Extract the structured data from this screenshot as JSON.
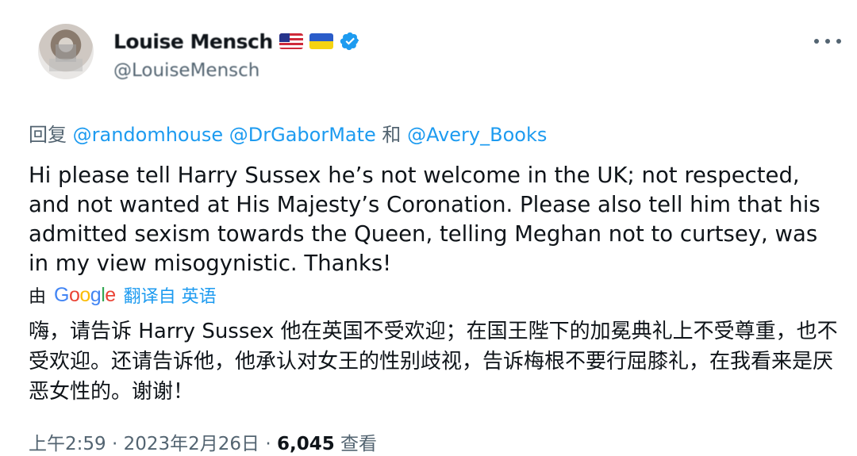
{
  "author": {
    "display_name": "Louise Mensch",
    "handle": "@LouiseMensch",
    "flags": [
      "us-flag-icon",
      "ukraine-flag-icon"
    ],
    "verified_icon": "verified-badge-icon"
  },
  "more_icon": "more-options-icon",
  "reply": {
    "prefix": "回复",
    "mentions": [
      "@randomhouse",
      "@DrGaborMate",
      "@Avery_Books"
    ],
    "conjunction": "和"
  },
  "tweet_text": "Hi please tell Harry Sussex he’s not welcome in the UK; not respected, and not wanted at His Majesty’s Coronation. Please also tell him that his admitted sexism towards the Queen, telling Meghan not to curtsey, was in my view misogynistic. Thanks!",
  "translation": {
    "by_label": "由",
    "provider": "Google",
    "translated_from": "翻译自 英语",
    "text": "嗨，请告诉 Harry Sussex 他在英国不受欢迎；在国王陛下的加冕典礼上不受尊重，也不受欢迎。还请告诉他，他承认对女王的性别歧视，告诉梅根不要行屈膝礼，在我看来是厌恶女性的。谢谢！"
  },
  "meta": {
    "time": "上午2:59",
    "date": "2023年2月26日",
    "separator": "·",
    "views_count": "6,045",
    "views_label": "查看"
  },
  "colors": {
    "link": "#1d9bf0",
    "secondary_text": "#536471",
    "primary_text": "#0f1419"
  }
}
